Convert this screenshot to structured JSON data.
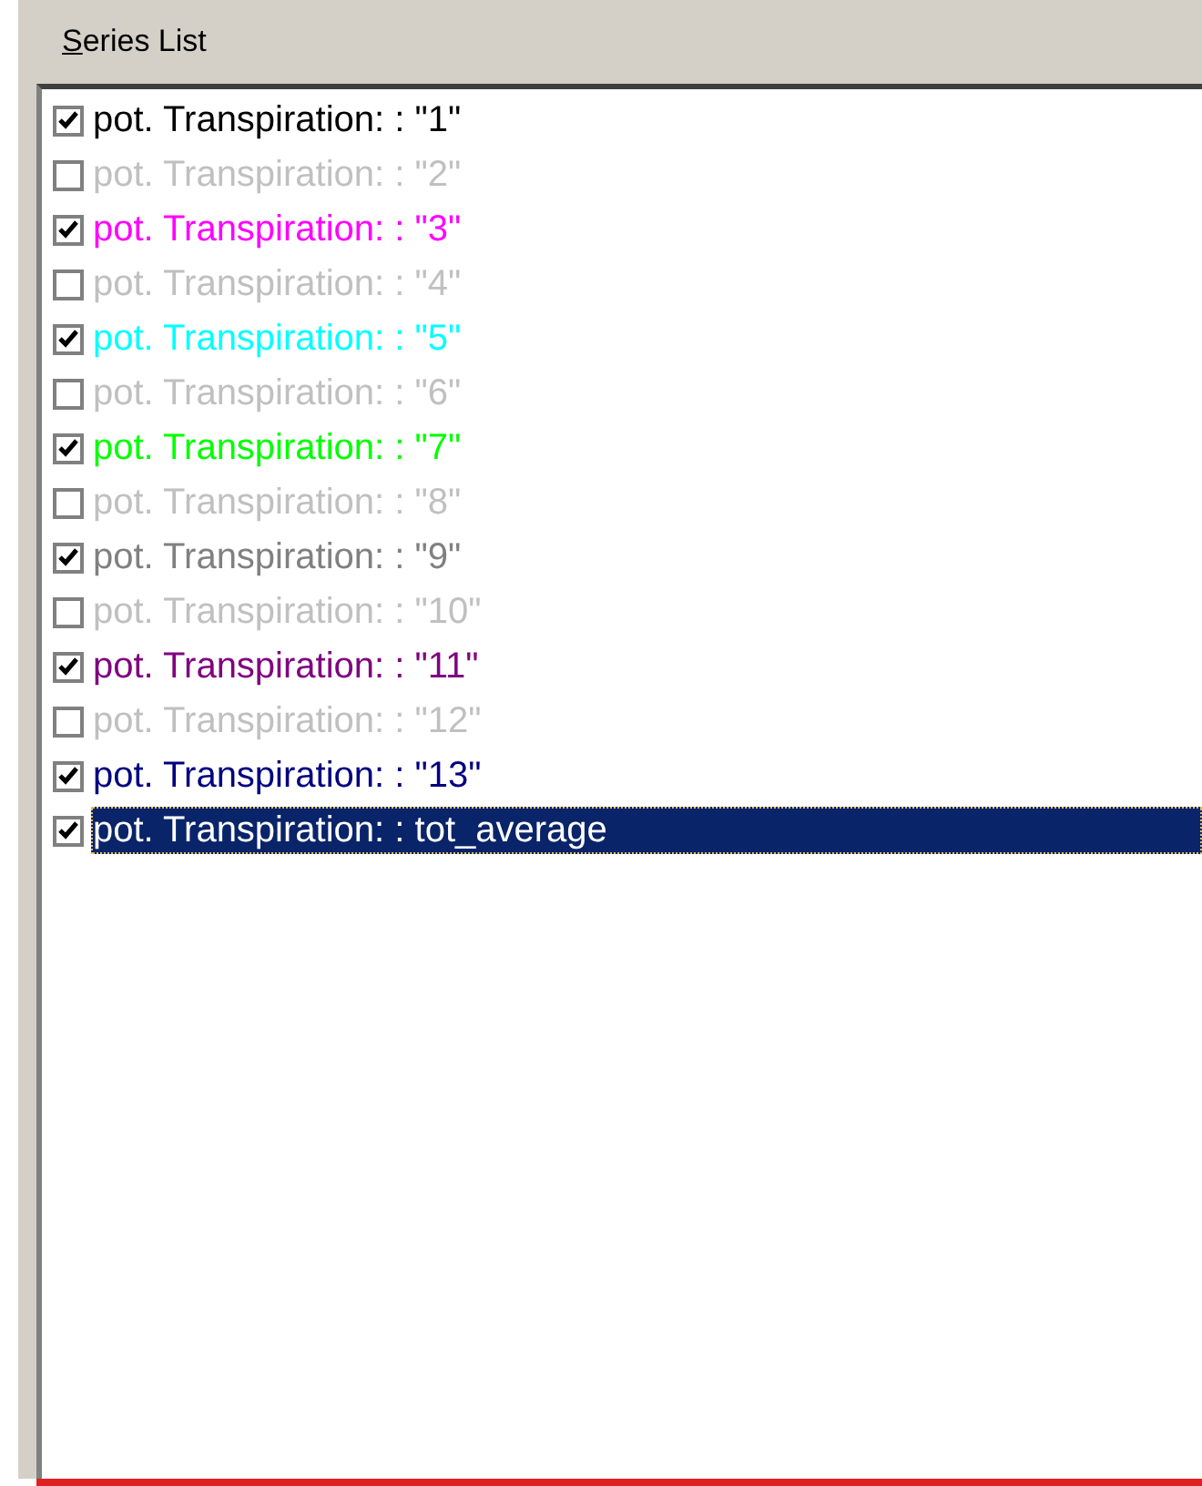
{
  "panel": {
    "label": "Series List",
    "label_mnemonic_first": true
  },
  "series": [
    {
      "label": "pot. Transpiration: : \"1\"",
      "checked": true,
      "selected": false,
      "color": "#000000"
    },
    {
      "label": "pot. Transpiration: : \"2\"",
      "checked": false,
      "selected": false
    },
    {
      "label": "pot. Transpiration: : \"3\"",
      "checked": true,
      "selected": false,
      "color": "#ff00ff"
    },
    {
      "label": "pot. Transpiration: : \"4\"",
      "checked": false,
      "selected": false
    },
    {
      "label": "pot. Transpiration: : \"5\"",
      "checked": true,
      "selected": false,
      "color": "#00ffff"
    },
    {
      "label": "pot. Transpiration: : \"6\"",
      "checked": false,
      "selected": false
    },
    {
      "label": "pot. Transpiration: : \"7\"",
      "checked": true,
      "selected": false,
      "color": "#00ff00"
    },
    {
      "label": "pot. Transpiration: : \"8\"",
      "checked": false,
      "selected": false
    },
    {
      "label": "pot. Transpiration: : \"9\"",
      "checked": true,
      "selected": false,
      "color": "#808080"
    },
    {
      "label": "pot. Transpiration: : \"10\"",
      "checked": false,
      "selected": false
    },
    {
      "label": "pot. Transpiration: : \"11\"",
      "checked": true,
      "selected": false,
      "color": "#800080"
    },
    {
      "label": "pot. Transpiration: : \"12\"",
      "checked": false,
      "selected": false
    },
    {
      "label": "pot. Transpiration: : \"13\"",
      "checked": true,
      "selected": false,
      "color": "#000080"
    },
    {
      "label": "pot. Transpiration: : tot_average",
      "checked": true,
      "selected": true
    }
  ]
}
